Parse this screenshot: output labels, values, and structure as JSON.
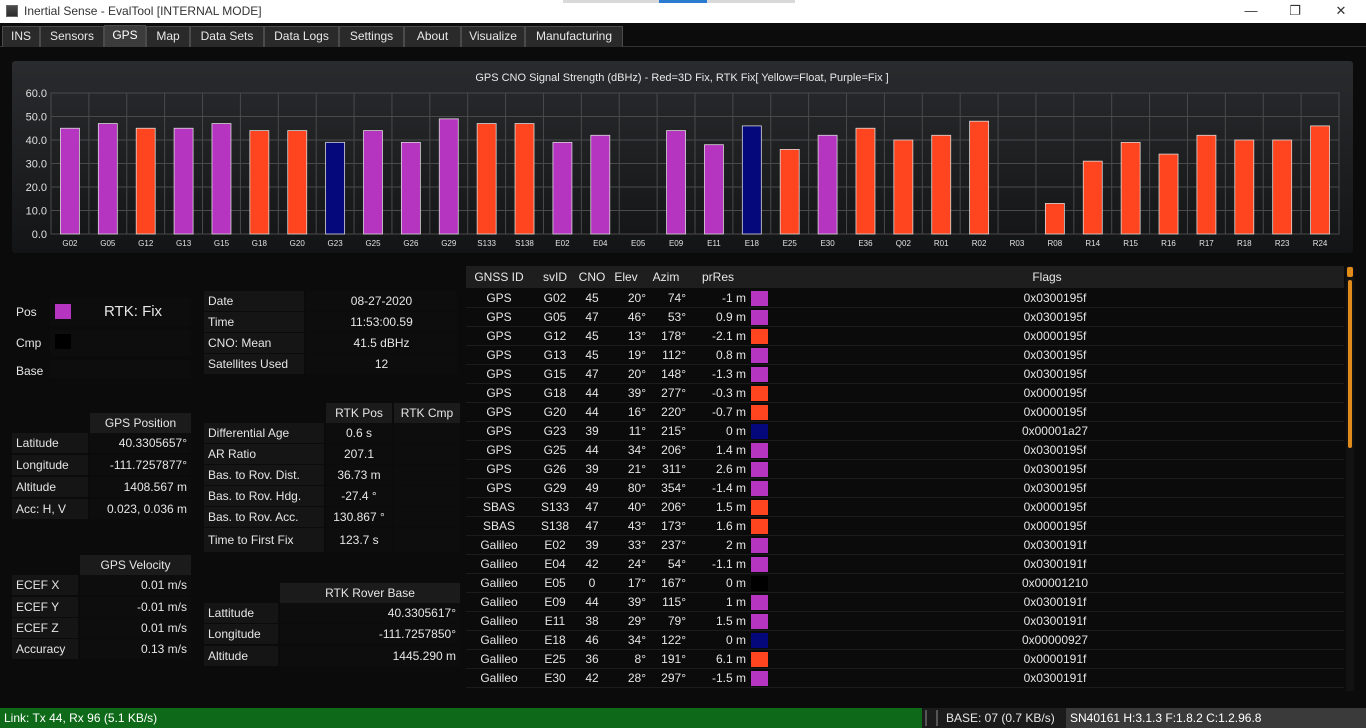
{
  "window": {
    "title": "Inertial Sense - EvalTool [INTERNAL MODE]",
    "min_glyph": "—",
    "max_glyph": "❐",
    "close_glyph": "✕"
  },
  "tabs": [
    "INS",
    "Sensors",
    "GPS",
    "Map",
    "Data Sets",
    "Data Logs",
    "Settings",
    "About",
    "Visualize",
    "Manufacturing"
  ],
  "active_tab": "GPS",
  "colors": {
    "fix": "#b535c0",
    "three_d": "#ff4520",
    "float": "#05087a",
    "none": "#000000",
    "link_ok": "#0e6a18",
    "scroll": "#e08b1a"
  },
  "chart_data": {
    "type": "bar",
    "title": "GPS CNO Signal Strength (dBHz) - Red=3D Fix, RTK Fix[ Yellow=Float, Purple=Fix ]",
    "ylim": [
      0,
      60
    ],
    "yticks": [
      "60.0",
      "50.0",
      "40.0",
      "30.0",
      "20.0",
      "10.0",
      "0.0"
    ],
    "grid": true,
    "categories": [
      "G02",
      "G05",
      "G12",
      "G13",
      "G15",
      "G18",
      "G20",
      "G23",
      "G25",
      "G26",
      "G29",
      "S133",
      "S138",
      "E02",
      "E04",
      "E05",
      "E09",
      "E11",
      "E18",
      "E25",
      "E30",
      "E36",
      "Q02",
      "R01",
      "R02",
      "R03",
      "R08",
      "R14",
      "R15",
      "R16",
      "R17",
      "R18",
      "R23",
      "R24"
    ],
    "values": [
      45,
      47,
      45,
      45,
      47,
      44,
      44,
      39,
      44,
      39,
      49,
      47,
      47,
      39,
      42,
      0,
      44,
      38,
      46,
      36,
      42,
      45,
      40,
      42,
      48,
      0,
      13,
      31,
      39,
      34,
      42,
      40,
      40,
      46
    ],
    "bar_colors": [
      "fix",
      "fix",
      "three_d",
      "fix",
      "fix",
      "three_d",
      "three_d",
      "float",
      "fix",
      "fix",
      "fix",
      "three_d",
      "three_d",
      "fix",
      "fix",
      "none",
      "fix",
      "fix",
      "float",
      "three_d",
      "fix",
      "three_d",
      "three_d",
      "three_d",
      "three_d",
      "none",
      "three_d",
      "three_d",
      "three_d",
      "three_d",
      "three_d",
      "three_d",
      "three_d",
      "three_d"
    ]
  },
  "status_panel": {
    "pos_label": "Pos",
    "pos_value": "RTK: Fix",
    "cmp_label": "Cmp",
    "base_label": "Base"
  },
  "gps_position": {
    "header": "GPS Position",
    "rows": [
      {
        "label": "Latitude",
        "value": "40.3305657°"
      },
      {
        "label": "Longitude",
        "value": "-111.7257877°"
      },
      {
        "label": "Altitude",
        "value": "1408.567 m"
      },
      {
        "label": "Acc: H, V",
        "value": "0.023, 0.036 m"
      }
    ]
  },
  "gps_velocity": {
    "header": "GPS Velocity",
    "rows": [
      {
        "label": "ECEF X",
        "value": "0.01 m/s"
      },
      {
        "label": "ECEF Y",
        "value": "-0.01 m/s"
      },
      {
        "label": "ECEF Z",
        "value": "0.01 m/s"
      },
      {
        "label": "Accuracy",
        "value": "0.13 m/s"
      }
    ]
  },
  "time_info": {
    "rows": [
      {
        "label": "Date",
        "value": "08-27-2020"
      },
      {
        "label": "Time",
        "value": "11:53:00.59"
      },
      {
        "label": "CNO: Mean",
        "value": "41.5 dBHz"
      },
      {
        "label": "Satellites Used",
        "value": "12"
      }
    ]
  },
  "rtk_info": {
    "col_pos": "RTK Pos",
    "col_cmp": "RTK Cmp",
    "rows": [
      {
        "label": "Differential Age",
        "pos": "0.6 s",
        "cmp": ""
      },
      {
        "label": "AR Ratio",
        "pos": "207.1",
        "cmp": ""
      },
      {
        "label": "Bas. to Rov. Dist.",
        "pos": "36.73 m",
        "cmp": ""
      },
      {
        "label": "Bas. to Rov. Hdg.",
        "pos": "-27.4 °",
        "cmp": ""
      },
      {
        "label": "Bas. to Rov. Acc.",
        "pos": "130.867 °",
        "cmp": ""
      },
      {
        "label": "Time to First Fix",
        "pos": "123.7 s",
        "cmp": ""
      }
    ]
  },
  "rtk_rover_base": {
    "header": "RTK Rover Base",
    "rows": [
      {
        "label": "Lattitude",
        "value": "40.3305617°"
      },
      {
        "label": "Longitude",
        "value": "-111.7257850°"
      },
      {
        "label": "Altitude",
        "value": "1445.290 m"
      }
    ]
  },
  "gnss_table": {
    "columns": [
      "GNSS ID",
      "svID",
      "CNO",
      "Elev",
      "Azim",
      "prRes",
      "Flags"
    ],
    "rows": [
      {
        "sys": "GPS",
        "sv": "G02",
        "cno": "45",
        "elev": "20°",
        "azim": "74°",
        "prres": "-1 m",
        "color": "fix",
        "flags": "0x0300195f"
      },
      {
        "sys": "GPS",
        "sv": "G05",
        "cno": "47",
        "elev": "46°",
        "azim": "53°",
        "prres": "0.9 m",
        "color": "fix",
        "flags": "0x0300195f"
      },
      {
        "sys": "GPS",
        "sv": "G12",
        "cno": "45",
        "elev": "13°",
        "azim": "178°",
        "prres": "-2.1 m",
        "color": "three_d",
        "flags": "0x0000195f"
      },
      {
        "sys": "GPS",
        "sv": "G13",
        "cno": "45",
        "elev": "19°",
        "azim": "112°",
        "prres": "0.8 m",
        "color": "fix",
        "flags": "0x0300195f"
      },
      {
        "sys": "GPS",
        "sv": "G15",
        "cno": "47",
        "elev": "20°",
        "azim": "148°",
        "prres": "-1.3 m",
        "color": "fix",
        "flags": "0x0300195f"
      },
      {
        "sys": "GPS",
        "sv": "G18",
        "cno": "44",
        "elev": "39°",
        "azim": "277°",
        "prres": "-0.3 m",
        "color": "three_d",
        "flags": "0x0000195f"
      },
      {
        "sys": "GPS",
        "sv": "G20",
        "cno": "44",
        "elev": "16°",
        "azim": "220°",
        "prres": "-0.7 m",
        "color": "three_d",
        "flags": "0x0000195f"
      },
      {
        "sys": "GPS",
        "sv": "G23",
        "cno": "39",
        "elev": "11°",
        "azim": "215°",
        "prres": "0 m",
        "color": "float",
        "flags": "0x00001a27"
      },
      {
        "sys": "GPS",
        "sv": "G25",
        "cno": "44",
        "elev": "34°",
        "azim": "206°",
        "prres": "1.4 m",
        "color": "fix",
        "flags": "0x0300195f"
      },
      {
        "sys": "GPS",
        "sv": "G26",
        "cno": "39",
        "elev": "21°",
        "azim": "311°",
        "prres": "2.6 m",
        "color": "fix",
        "flags": "0x0300195f"
      },
      {
        "sys": "GPS",
        "sv": "G29",
        "cno": "49",
        "elev": "80°",
        "azim": "354°",
        "prres": "-1.4 m",
        "color": "fix",
        "flags": "0x0300195f"
      },
      {
        "sys": "SBAS",
        "sv": "S133",
        "cno": "47",
        "elev": "40°",
        "azim": "206°",
        "prres": "1.5 m",
        "color": "three_d",
        "flags": "0x0000195f"
      },
      {
        "sys": "SBAS",
        "sv": "S138",
        "cno": "47",
        "elev": "43°",
        "azim": "173°",
        "prres": "1.6 m",
        "color": "three_d",
        "flags": "0x0000195f"
      },
      {
        "sys": "Galileo",
        "sv": "E02",
        "cno": "39",
        "elev": "33°",
        "azim": "237°",
        "prres": "2 m",
        "color": "fix",
        "flags": "0x0300191f"
      },
      {
        "sys": "Galileo",
        "sv": "E04",
        "cno": "42",
        "elev": "24°",
        "azim": "54°",
        "prres": "-1.1 m",
        "color": "fix",
        "flags": "0x0300191f"
      },
      {
        "sys": "Galileo",
        "sv": "E05",
        "cno": "0",
        "elev": "17°",
        "azim": "167°",
        "prres": "0 m",
        "color": "none",
        "flags": "0x00001210"
      },
      {
        "sys": "Galileo",
        "sv": "E09",
        "cno": "44",
        "elev": "39°",
        "azim": "115°",
        "prres": "1 m",
        "color": "fix",
        "flags": "0x0300191f"
      },
      {
        "sys": "Galileo",
        "sv": "E11",
        "cno": "38",
        "elev": "29°",
        "azim": "79°",
        "prres": "1.5 m",
        "color": "fix",
        "flags": "0x0300191f"
      },
      {
        "sys": "Galileo",
        "sv": "E18",
        "cno": "46",
        "elev": "34°",
        "azim": "122°",
        "prres": "0 m",
        "color": "float",
        "flags": "0x00000927"
      },
      {
        "sys": "Galileo",
        "sv": "E25",
        "cno": "36",
        "elev": "8°",
        "azim": "191°",
        "prres": "6.1 m",
        "color": "three_d",
        "flags": "0x0000191f"
      },
      {
        "sys": "Galileo",
        "sv": "E30",
        "cno": "42",
        "elev": "28°",
        "azim": "297°",
        "prres": "-1.5 m",
        "color": "fix",
        "flags": "0x0300191f"
      }
    ]
  },
  "statusbar": {
    "link": "Link: Tx 44, Rx 96  (5.1 KB/s)",
    "base": "BASE: 07  (0.7 KB/s)",
    "sn": "SN40161  H:3.1.3  F:1.8.2  C:1.2.96.8"
  }
}
